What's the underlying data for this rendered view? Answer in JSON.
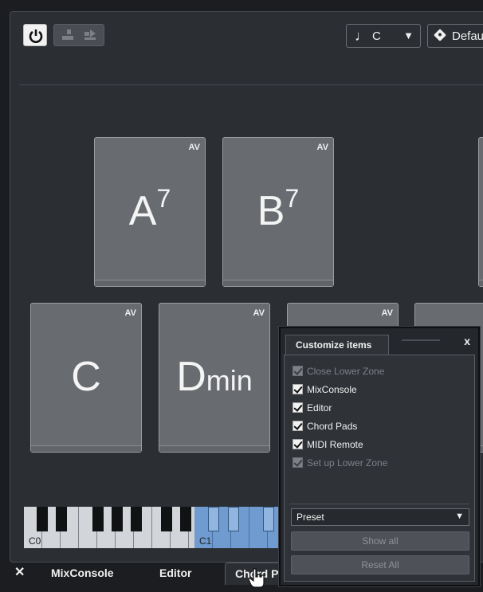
{
  "toolbar": {
    "key_selector": {
      "note_icon": "♩",
      "value": "C",
      "arrow": "▼"
    },
    "preset_selector": {
      "icon": "preset-icon",
      "value": "Default"
    }
  },
  "pads": {
    "row1": [
      {
        "root": "A",
        "ext": "7",
        "badge": "AV"
      },
      {
        "root": "B",
        "ext": "7",
        "badge": "AV"
      }
    ],
    "row2": [
      {
        "root": "C",
        "ext": "",
        "badge": "AV"
      },
      {
        "root": "D",
        "ext": "min",
        "badge": "AV"
      },
      {
        "root": "",
        "ext": "",
        "badge": "AV"
      }
    ]
  },
  "keyboard": {
    "labels": [
      "C0",
      "C1"
    ]
  },
  "bottom_tabs": {
    "close": "✕",
    "items": [
      "MixConsole",
      "Editor",
      "Chord P"
    ]
  },
  "popup": {
    "title": "Customize items",
    "close": "x",
    "options": [
      {
        "label": "Close Lower Zone",
        "checked": true,
        "disabled": true
      },
      {
        "label": "MixConsole",
        "checked": true,
        "disabled": false
      },
      {
        "label": "Editor",
        "checked": true,
        "disabled": false
      },
      {
        "label": "Chord Pads",
        "checked": true,
        "disabled": false
      },
      {
        "label": "MIDI Remote",
        "checked": true,
        "disabled": false
      },
      {
        "label": "Set up Lower Zone",
        "checked": true,
        "disabled": true
      }
    ],
    "preset": {
      "value": "Preset",
      "arrow": "▼"
    },
    "show_all": "Show all",
    "reset_all": "Reset All"
  }
}
